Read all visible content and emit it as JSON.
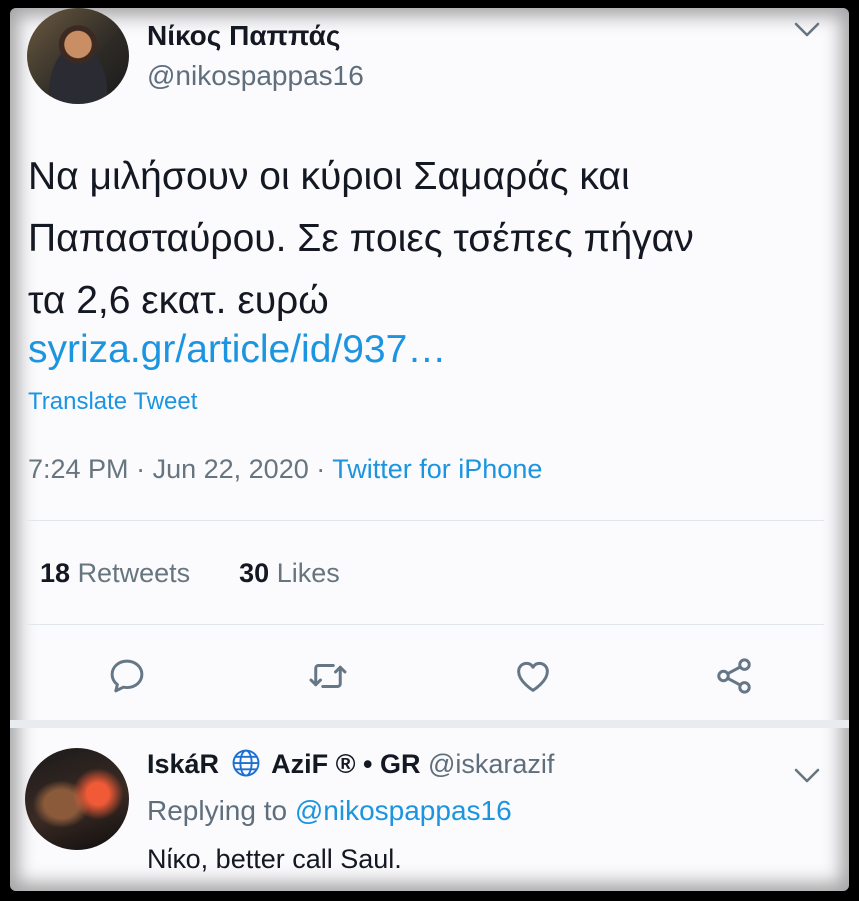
{
  "tweet": {
    "author_name": "Νίκος Παππάς",
    "author_handle": "@nikospappas16",
    "text_line1": "Να μιλήσουν οι κύριοι Σαμαράς και",
    "text_line2": "Παπασταύρου. Σε ποιες τσέπες πήγαν",
    "text_line3": "τα 2,6 εκατ. ευρώ",
    "link": "syriza.gr/article/id/937…",
    "translate_label": "Translate Tweet",
    "time": "7:24 PM",
    "date": "Jun 22, 2020",
    "separator": "·",
    "source": "Twitter for iPhone",
    "retweets_count": "18",
    "retweets_label": "Retweets",
    "likes_count": "30",
    "likes_label": "Likes"
  },
  "actions": [
    {
      "name": "reply-icon"
    },
    {
      "name": "retweet-icon"
    },
    {
      "name": "like-icon"
    },
    {
      "name": "share-icon"
    }
  ],
  "reply": {
    "author_name_part1": "IskáR",
    "author_name_part2": "AziF",
    "author_name_part3": "® • GR",
    "author_handle": "@iskarazif",
    "replying_prefix": "Replying to",
    "replying_to": "@nikospappas16",
    "text": "Νίκο, better call Saul."
  },
  "colors": {
    "link": "#1b95e0",
    "text": "#141823",
    "secondary": "#66757f"
  }
}
